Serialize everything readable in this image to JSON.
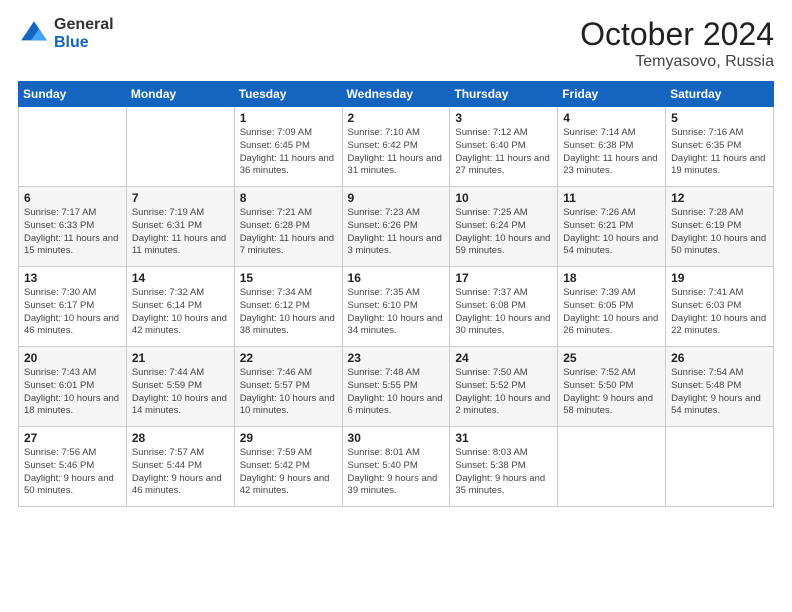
{
  "logo": {
    "general": "General",
    "blue": "Blue"
  },
  "header": {
    "month": "October 2024",
    "location": "Temyasovo, Russia"
  },
  "weekdays": [
    "Sunday",
    "Monday",
    "Tuesday",
    "Wednesday",
    "Thursday",
    "Friday",
    "Saturday"
  ],
  "weeks": [
    [
      {
        "day": "",
        "info": ""
      },
      {
        "day": "",
        "info": ""
      },
      {
        "day": "1",
        "info": "Sunrise: 7:09 AM\nSunset: 6:45 PM\nDaylight: 11 hours and 36 minutes."
      },
      {
        "day": "2",
        "info": "Sunrise: 7:10 AM\nSunset: 6:42 PM\nDaylight: 11 hours and 31 minutes."
      },
      {
        "day": "3",
        "info": "Sunrise: 7:12 AM\nSunset: 6:40 PM\nDaylight: 11 hours and 27 minutes."
      },
      {
        "day": "4",
        "info": "Sunrise: 7:14 AM\nSunset: 6:38 PM\nDaylight: 11 hours and 23 minutes."
      },
      {
        "day": "5",
        "info": "Sunrise: 7:16 AM\nSunset: 6:35 PM\nDaylight: 11 hours and 19 minutes."
      }
    ],
    [
      {
        "day": "6",
        "info": "Sunrise: 7:17 AM\nSunset: 6:33 PM\nDaylight: 11 hours and 15 minutes."
      },
      {
        "day": "7",
        "info": "Sunrise: 7:19 AM\nSunset: 6:31 PM\nDaylight: 11 hours and 11 minutes."
      },
      {
        "day": "8",
        "info": "Sunrise: 7:21 AM\nSunset: 6:28 PM\nDaylight: 11 hours and 7 minutes."
      },
      {
        "day": "9",
        "info": "Sunrise: 7:23 AM\nSunset: 6:26 PM\nDaylight: 11 hours and 3 minutes."
      },
      {
        "day": "10",
        "info": "Sunrise: 7:25 AM\nSunset: 6:24 PM\nDaylight: 10 hours and 59 minutes."
      },
      {
        "day": "11",
        "info": "Sunrise: 7:26 AM\nSunset: 6:21 PM\nDaylight: 10 hours and 54 minutes."
      },
      {
        "day": "12",
        "info": "Sunrise: 7:28 AM\nSunset: 6:19 PM\nDaylight: 10 hours and 50 minutes."
      }
    ],
    [
      {
        "day": "13",
        "info": "Sunrise: 7:30 AM\nSunset: 6:17 PM\nDaylight: 10 hours and 46 minutes."
      },
      {
        "day": "14",
        "info": "Sunrise: 7:32 AM\nSunset: 6:14 PM\nDaylight: 10 hours and 42 minutes."
      },
      {
        "day": "15",
        "info": "Sunrise: 7:34 AM\nSunset: 6:12 PM\nDaylight: 10 hours and 38 minutes."
      },
      {
        "day": "16",
        "info": "Sunrise: 7:35 AM\nSunset: 6:10 PM\nDaylight: 10 hours and 34 minutes."
      },
      {
        "day": "17",
        "info": "Sunrise: 7:37 AM\nSunset: 6:08 PM\nDaylight: 10 hours and 30 minutes."
      },
      {
        "day": "18",
        "info": "Sunrise: 7:39 AM\nSunset: 6:05 PM\nDaylight: 10 hours and 26 minutes."
      },
      {
        "day": "19",
        "info": "Sunrise: 7:41 AM\nSunset: 6:03 PM\nDaylight: 10 hours and 22 minutes."
      }
    ],
    [
      {
        "day": "20",
        "info": "Sunrise: 7:43 AM\nSunset: 6:01 PM\nDaylight: 10 hours and 18 minutes."
      },
      {
        "day": "21",
        "info": "Sunrise: 7:44 AM\nSunset: 5:59 PM\nDaylight: 10 hours and 14 minutes."
      },
      {
        "day": "22",
        "info": "Sunrise: 7:46 AM\nSunset: 5:57 PM\nDaylight: 10 hours and 10 minutes."
      },
      {
        "day": "23",
        "info": "Sunrise: 7:48 AM\nSunset: 5:55 PM\nDaylight: 10 hours and 6 minutes."
      },
      {
        "day": "24",
        "info": "Sunrise: 7:50 AM\nSunset: 5:52 PM\nDaylight: 10 hours and 2 minutes."
      },
      {
        "day": "25",
        "info": "Sunrise: 7:52 AM\nSunset: 5:50 PM\nDaylight: 9 hours and 58 minutes."
      },
      {
        "day": "26",
        "info": "Sunrise: 7:54 AM\nSunset: 5:48 PM\nDaylight: 9 hours and 54 minutes."
      }
    ],
    [
      {
        "day": "27",
        "info": "Sunrise: 7:56 AM\nSunset: 5:46 PM\nDaylight: 9 hours and 50 minutes."
      },
      {
        "day": "28",
        "info": "Sunrise: 7:57 AM\nSunset: 5:44 PM\nDaylight: 9 hours and 46 minutes."
      },
      {
        "day": "29",
        "info": "Sunrise: 7:59 AM\nSunset: 5:42 PM\nDaylight: 9 hours and 42 minutes."
      },
      {
        "day": "30",
        "info": "Sunrise: 8:01 AM\nSunset: 5:40 PM\nDaylight: 9 hours and 39 minutes."
      },
      {
        "day": "31",
        "info": "Sunrise: 8:03 AM\nSunset: 5:38 PM\nDaylight: 9 hours and 35 minutes."
      },
      {
        "day": "",
        "info": ""
      },
      {
        "day": "",
        "info": ""
      }
    ]
  ]
}
